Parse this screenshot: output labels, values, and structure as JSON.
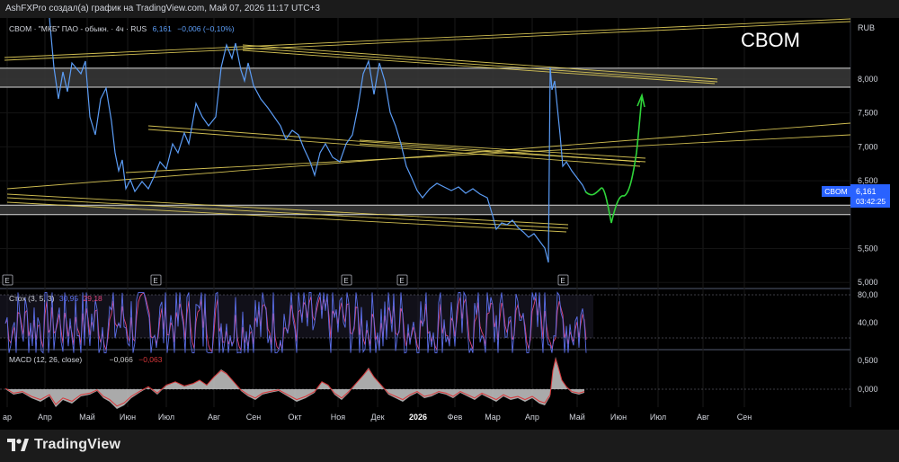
{
  "header": {
    "attribution": "AshFXPro создал(а) график на TradingView.com, Май 07, 2026 11:17 UTC+3"
  },
  "brand": {
    "name": "TradingView"
  },
  "price_pane": {
    "legend": {
      "text": "СВОМ · \"МКБ\" ПАО - обыкн. · 4ч · RUS",
      "last": "6,161",
      "change": "−0,006 (−0,10%)"
    },
    "watermark": "CBOM",
    "currency": "RUB",
    "price_badge": {
      "ticker": "CBOM",
      "price": "6,161",
      "countdown": "03:42:25"
    }
  },
  "stoch_pane": {
    "label": "Стох (3, 5, 3)",
    "value_k": "30,95",
    "value_d": "29,18"
  },
  "macd_pane": {
    "label": "MACD (12, 26, close)",
    "value_macd": "−0,066",
    "value_signal": "−0,063"
  },
  "colors": {
    "background": "#000000",
    "price_line": "#5b9cf5",
    "trend_lines": "#e6d25a",
    "forecast": "#2fd43a",
    "stoch_k": "#5b6ee8",
    "stoch_d": "#e0457b",
    "macd_line": "#d9373a",
    "macd_hist": "#c8c8c8",
    "zone_border": "#d8d8d8"
  },
  "chart_data": [
    {
      "type": "line",
      "title": "СВОМ · \"МКБ\" ПАО - обыкн. · 4ч · RUS",
      "x": [
        "Мар",
        "Апр",
        "Май",
        "Июн",
        "Июл",
        "Авг",
        "Сен",
        "Окт",
        "Ноя",
        "Дек",
        "2026",
        "Фев",
        "Мар",
        "Апр",
        "Май"
      ],
      "series": [
        {
          "name": "СВОМ",
          "values": [
            8.6,
            7.8,
            7.7,
            6.2,
            6.5,
            8.2,
            7.4,
            7.5,
            7.0,
            8.0,
            6.2,
            6.1,
            5.7,
            5.4,
            6.2
          ]
        }
      ],
      "y_ticks": [
        "8,000",
        "7,500",
        "7,000",
        "6,500",
        "6,000",
        "5,500",
        "5,000"
      ],
      "x_ticks": [
        "ар",
        "Апр",
        "Май",
        "Июн",
        "Июл",
        "Авг",
        "Сен",
        "Окт",
        "Ноя",
        "Дек",
        "2026",
        "Фев",
        "Мар",
        "Апр",
        "Май",
        "Июн",
        "Июл",
        "Авг",
        "Сен"
      ],
      "ylim": [
        4.95,
        8.9
      ],
      "zones": [
        [
          7.88,
          8.16
        ],
        [
          6.0,
          6.14
        ]
      ],
      "earnings_markers": [
        "Май",
        "Авг",
        "Дек",
        "Янв",
        "Апр"
      ],
      "forecast": [
        6.1,
        6.0,
        6.15,
        5.7,
        6.1,
        6.15,
        6.8,
        7.65
      ]
    },
    {
      "type": "line",
      "title": "Стох (3, 5, 3)",
      "series": [
        {
          "name": "%K",
          "values": []
        },
        {
          "name": "%D",
          "values": []
        }
      ],
      "y_ticks": [
        "80,00",
        "40,00"
      ]
    },
    {
      "type": "bar",
      "title": "MACD (12, 26, close)",
      "y_ticks": [
        "0,500",
        "0,000"
      ]
    }
  ]
}
